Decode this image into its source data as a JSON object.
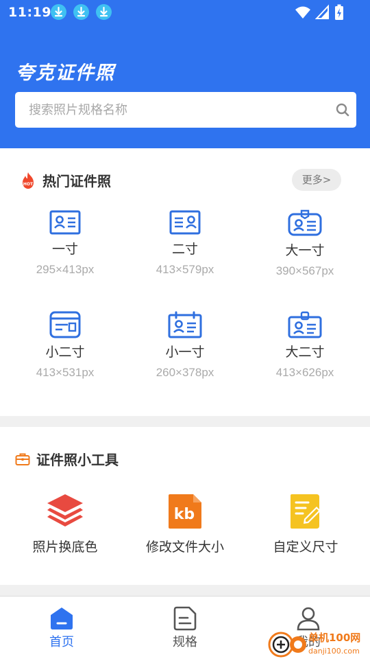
{
  "status_bar": {
    "time": "11:19",
    "icons": [
      "download-icon",
      "download-icon",
      "download-icon",
      "wifi-icon",
      "signal-icon",
      "battery-charging-icon"
    ]
  },
  "app": {
    "title": "夸克证件照"
  },
  "search": {
    "placeholder": "搜索照片规格名称",
    "value": ""
  },
  "hot_section": {
    "title": "热门证件照",
    "more_label": "更多>",
    "items": [
      {
        "name": "一寸",
        "size": "295×413px",
        "icon": "id-card-icon"
      },
      {
        "name": "二寸",
        "size": "413×579px",
        "icon": "id-card-icon"
      },
      {
        "name": "大一寸",
        "size": "390×567px",
        "icon": "badge-icon"
      },
      {
        "name": "小二寸",
        "size": "413×531px",
        "icon": "card-icon"
      },
      {
        "name": "小一寸",
        "size": "260×378px",
        "icon": "calendar-card-icon"
      },
      {
        "name": "大二寸",
        "size": "413×626px",
        "icon": "lock-badge-icon"
      }
    ]
  },
  "tools_section": {
    "title": "证件照小工具",
    "items": [
      {
        "name": "照片换底色",
        "icon": "layers-icon",
        "color": "#e84a40"
      },
      {
        "name": "修改文件大小",
        "icon": "kb-file-icon",
        "color": "#f07a1b",
        "badge": "kb"
      },
      {
        "name": "自定义尺寸",
        "icon": "edit-doc-icon",
        "color": "#f5c321"
      }
    ]
  },
  "bottom_nav": {
    "items": [
      {
        "label": "首页",
        "icon": "home-icon",
        "active": true
      },
      {
        "label": "规格",
        "icon": "document-icon",
        "active": false
      },
      {
        "label": "我的",
        "icon": "user-icon",
        "active": false
      }
    ]
  },
  "watermark": {
    "brand": "单机100网",
    "url": "danji100.com"
  },
  "colors": {
    "primary": "#2f73ef",
    "icon_blue": "#2f6fdf",
    "hot_red": "#f0482c",
    "tools_orange": "#f07a1b",
    "text_gray": "#aaaaaa"
  }
}
